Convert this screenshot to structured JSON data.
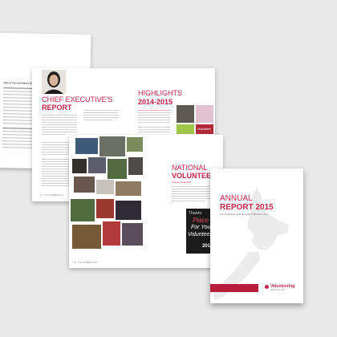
{
  "back_page": {
    "heading": "Note 8: Reconciliation of Net Surplus"
  },
  "ce_spread": {
    "title_line1": "CHIEF EXECUTIVE'S",
    "title_line2": "REPORT",
    "highlights_line1": "HIGHLIGHTS",
    "highlights_line2": "2014-2015",
    "poster_text": "Volunteer",
    "folio": "16 · VOLUNTEERING NZ"
  },
  "nv_spread": {
    "title_line1": "NATIONAL",
    "title_line2": "VOLUNTEER",
    "tagline": "Volunteer Week 2015",
    "poster_line1": "Thanks",
    "poster_line2": "Place",
    "poster_line3": "For You",
    "poster_line4": "Volunteer",
    "poster_year": "2015",
    "folio": "18 · VOLUNTEERING NZ"
  },
  "cover": {
    "title_line1": "ANNUAL",
    "title_line2": "REPORT 2015",
    "subtitle": "VOLUNTEERING NEW ZEALAND PURONGO A TAU",
    "logo_text": "Volunteering",
    "logo_subtext": "NEW ZEALAND"
  },
  "colors": {
    "accent": "#c6264a",
    "background": "#e9e9e9"
  }
}
